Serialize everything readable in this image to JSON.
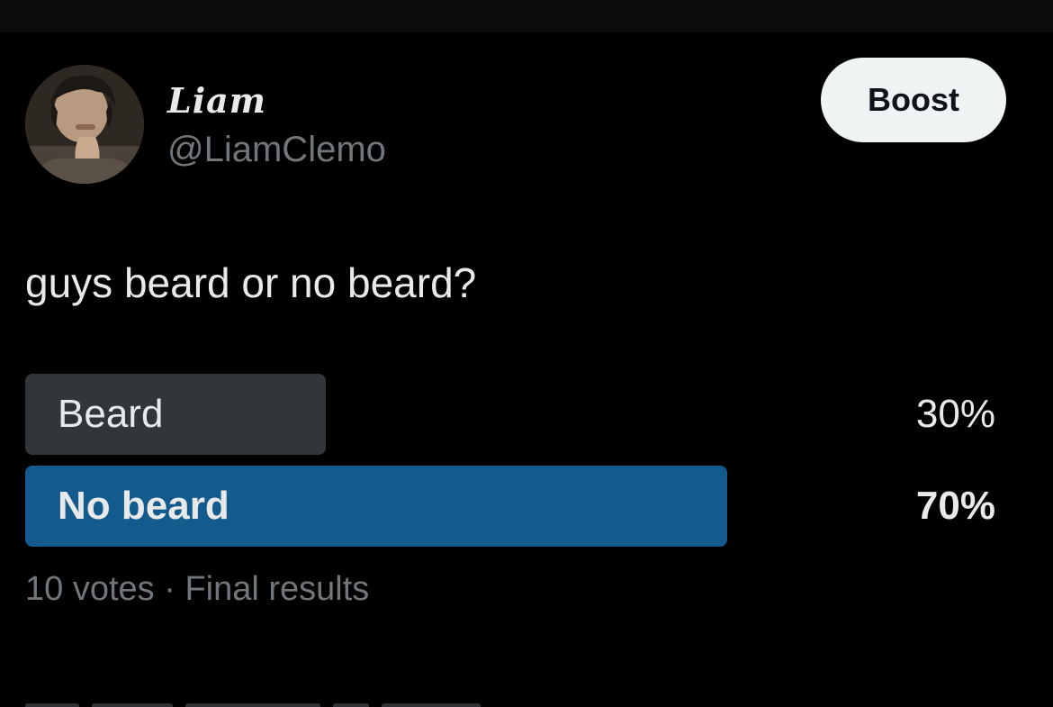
{
  "post": {
    "author": {
      "display_name": "Liam",
      "handle": "@LiamClemo"
    },
    "boost_label": "Boost",
    "text": "guys beard or no beard?"
  },
  "poll": {
    "options": [
      {
        "label": "Beard",
        "percent_text": "30%",
        "fraction": 0.3
      },
      {
        "label": "No beard",
        "percent_text": "70%",
        "fraction": 0.7,
        "winner": true
      }
    ],
    "votes_text": "10 votes",
    "separator": " · ",
    "status_text": "Final results"
  },
  "colors": {
    "background": "#000000",
    "text_primary": "#e7e9ea",
    "text_secondary": "#71767b",
    "poll_bar": "#333639",
    "poll_bar_winner": "#135a8d",
    "boost_bg": "#eff3f4"
  }
}
